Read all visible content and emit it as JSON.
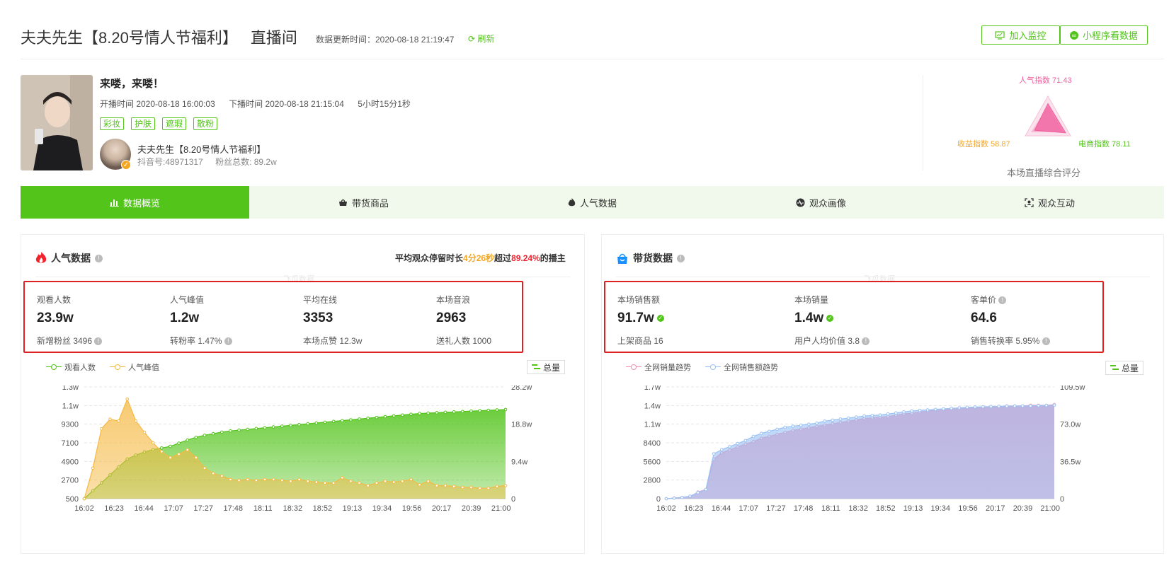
{
  "header": {
    "title": "夫夫先生【8.20号情人节福利】",
    "room_label": "直播间",
    "update_label": "数据更新时间：2020-08-18 21:19:47",
    "refresh_label": "刷新",
    "monitor_btn": "加入监控",
    "miniapp_btn": "小程序看数据"
  },
  "live": {
    "title": "来喽，来喽！",
    "start_time": "开播时间 2020-08-18 16:00:03",
    "end_time": "下播时间 2020-08-18 21:15:04",
    "duration": "5小时15分1秒",
    "tags": [
      "彩妆",
      "护肤",
      "遮瑕",
      "散粉"
    ],
    "anchor_name": "夫夫先生【8.20号情人节福利】",
    "douyin_id": "抖音号:48971317",
    "fans": "粉丝总数: 89.2w"
  },
  "radar": {
    "popularity": "人气指数 71.43",
    "income": "收益指数 58.87",
    "ecommerce": "电商指数 78.11",
    "caption": "本场直播综合评分",
    "popularity_value": 71.43,
    "income_value": 58.87,
    "ecommerce_value": 78.11,
    "color_popularity": "#f0609e",
    "color_income": "#f5a623",
    "color_ecommerce": "#52c41a"
  },
  "tabs": [
    {
      "label": "数据概览",
      "icon": "bar-chart-icon"
    },
    {
      "label": "带货商品",
      "icon": "basket-icon"
    },
    {
      "label": "人气数据",
      "icon": "flame-icon"
    },
    {
      "label": "观众画像",
      "icon": "pulse-icon"
    },
    {
      "label": "观众互动",
      "icon": "scan-face-icon"
    }
  ],
  "popularity_panel": {
    "title": "人气数据",
    "stay_prefix": "平均观众停留时长",
    "stay_time": "4分26秒",
    "stay_mid": "超过",
    "stay_pct": "89.24%",
    "stay_suffix": "的播主",
    "watermark": "飞瓜数据",
    "metrics": [
      {
        "label": "观看人数",
        "value": "23.9w",
        "sub": "新增粉丝 3496"
      },
      {
        "label": "人气峰值",
        "value": "1.2w",
        "sub": "转粉率 1.47%"
      },
      {
        "label": "平均在线",
        "value": "3353",
        "sub": "本场点赞 12.3w"
      },
      {
        "label": "本场音浪",
        "value": "2963",
        "sub": "送礼人数 1000"
      }
    ],
    "legend": [
      "观看人数",
      "人气峰值"
    ],
    "total_btn": "总量"
  },
  "sales_panel": {
    "title": "带货数据",
    "watermark": "飞瓜数据",
    "metrics": [
      {
        "label": "本场销售额",
        "value": "91.7w",
        "sub": "上架商品 16"
      },
      {
        "label": "本场销量",
        "value": "1.4w",
        "sub": "用户人均价值 3.8"
      },
      {
        "label": "客单价",
        "value": "64.6",
        "sub": "销售转换率 5.95%"
      }
    ],
    "legend": [
      "全网销量趋势",
      "全网销售额趋势"
    ],
    "total_btn": "总量"
  },
  "chart_data": [
    {
      "type": "area",
      "x_ticks": [
        "16:02",
        "16:23",
        "16:44",
        "17:07",
        "17:27",
        "17:48",
        "18:11",
        "18:32",
        "18:52",
        "19:13",
        "19:34",
        "19:56",
        "20:17",
        "20:39",
        "21:00"
      ],
      "left_ticks": [
        "500",
        "2700",
        "4900",
        "7100",
        "9300",
        "1.1w",
        "1.3w"
      ],
      "right_ticks": [
        "0",
        "9.4w",
        "18.8w",
        "28.2w"
      ],
      "left_range": [
        500,
        13300
      ],
      "right_range": [
        0,
        282000
      ],
      "series": [
        {
          "name": "观看人数",
          "axis": "right",
          "color": "#52c41a",
          "values": [
            0,
            20000,
            40000,
            60000,
            80000,
            100000,
            110000,
            118000,
            124000,
            128000,
            132000,
            140000,
            148000,
            155000,
            160000,
            164000,
            168000,
            171000,
            173000,
            175000,
            177000,
            179000,
            181000,
            183000,
            185000,
            187000,
            189000,
            191000,
            193000,
            195000,
            197000,
            199000,
            201000,
            203000,
            205000,
            207000,
            209000,
            211000,
            213000,
            215000,
            216000,
            217000,
            218000,
            219000,
            220000,
            221000,
            222000,
            223000,
            224000,
            225000
          ]
        },
        {
          "name": "人气峰值",
          "axis": "left",
          "color": "#f5b942",
          "values": [
            500,
            4000,
            8500,
            9600,
            9400,
            11900,
            9400,
            8100,
            6900,
            5900,
            5200,
            5600,
            6100,
            5200,
            4000,
            3400,
            3100,
            2700,
            2600,
            2700,
            2600,
            2700,
            2700,
            2600,
            2500,
            2700,
            2500,
            2400,
            2300,
            2300,
            2900,
            2500,
            2300,
            2000,
            2300,
            2500,
            2400,
            2500,
            2700,
            2100,
            2500,
            2000,
            2000,
            1900,
            1800,
            1800,
            1700,
            1700,
            1900,
            2000
          ]
        }
      ]
    },
    {
      "type": "area",
      "x_ticks": [
        "16:02",
        "16:23",
        "16:44",
        "17:07",
        "17:27",
        "17:48",
        "18:11",
        "18:32",
        "18:52",
        "19:13",
        "19:34",
        "19:56",
        "20:17",
        "20:39",
        "21:00"
      ],
      "left_ticks": [
        "0",
        "2800",
        "5600",
        "8400",
        "1.1w",
        "1.4w",
        "1.7w"
      ],
      "right_ticks": [
        "0",
        "36.5w",
        "73.0w",
        "109.5w"
      ],
      "left_range": [
        0,
        17000
      ],
      "right_range": [
        0,
        1095000
      ],
      "series": [
        {
          "name": "全网销量趋势",
          "axis": "left",
          "color": "#f08fb5",
          "values": [
            0,
            100,
            200,
            300,
            1000,
            1400,
            6000,
            7000,
            7400,
            7900,
            8300,
            8700,
            9200,
            9500,
            9800,
            10100,
            10400,
            10600,
            10800,
            11000,
            11200,
            11400,
            11600,
            11800,
            12000,
            12200,
            12300,
            12400,
            12500,
            12700,
            12900,
            13000,
            13200,
            13300,
            13500,
            13600,
            13700,
            13800,
            13800,
            13900,
            13900,
            14000,
            14000,
            14100,
            14100,
            14100,
            14200,
            14200,
            14200,
            14300
          ]
        },
        {
          "name": "全网销售额趋势",
          "axis": "right",
          "color": "#9ac2f5",
          "values": [
            0,
            5000,
            12000,
            25000,
            60000,
            90000,
            440000,
            480000,
            510000,
            540000,
            570000,
            610000,
            640000,
            660000,
            680000,
            700000,
            710000,
            720000,
            730000,
            740000,
            760000,
            770000,
            780000,
            790000,
            800000,
            810000,
            815000,
            820000,
            830000,
            840000,
            850000,
            860000,
            865000,
            870000,
            875000,
            880000,
            885000,
            890000,
            895000,
            898000,
            900000,
            903000,
            905000,
            907000,
            908000,
            909000,
            910000,
            912000,
            914000,
            917000
          ]
        }
      ]
    }
  ]
}
